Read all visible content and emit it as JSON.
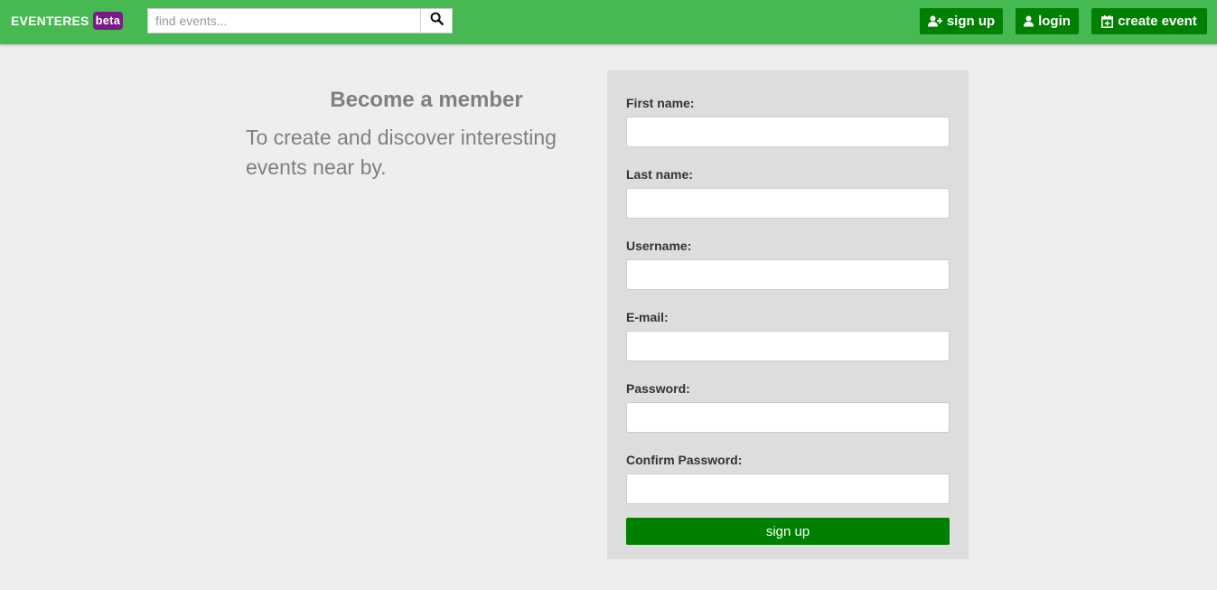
{
  "header": {
    "brand": "EVENTERES",
    "badge": "beta",
    "search_placeholder": "find events...",
    "search_value": "",
    "search_icon": "search-icon",
    "buttons": {
      "signup": {
        "label": "sign up",
        "icon": "user-plus-icon"
      },
      "login": {
        "label": "login",
        "icon": "user-icon"
      },
      "create": {
        "label": "create event",
        "icon": "calendar-plus-icon"
      }
    },
    "colors": {
      "bar": "#46b952",
      "button": "#008000",
      "badge": "#7a1a86"
    }
  },
  "intro": {
    "title": "Become a member",
    "text": "To create and discover interesting events near by."
  },
  "form": {
    "fields": [
      {
        "label": "First name:",
        "value": ""
      },
      {
        "label": "Last name:",
        "value": ""
      },
      {
        "label": "Username:",
        "value": ""
      },
      {
        "label": "E-mail:",
        "value": ""
      },
      {
        "label": "Password:",
        "value": ""
      },
      {
        "label": "Confirm Password:",
        "value": ""
      }
    ],
    "submit_label": "sign up"
  }
}
